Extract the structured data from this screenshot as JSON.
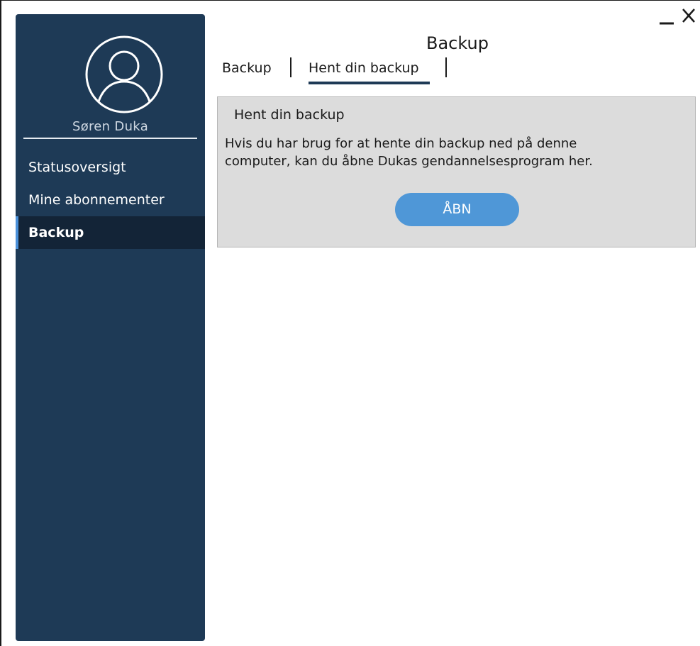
{
  "window": {
    "minimize_icon": "minimize-icon",
    "close_icon": "close-icon"
  },
  "sidebar": {
    "avatar_icon": "user-avatar-icon",
    "user_name": "Søren Duka",
    "items": [
      {
        "label": "Statusoversigt",
        "active": false
      },
      {
        "label": "Mine abonnementer",
        "active": false
      },
      {
        "label": "Backup",
        "active": true
      }
    ]
  },
  "header": {
    "title": "Backup"
  },
  "tabs": [
    {
      "label": "Backup",
      "active": false
    },
    {
      "label": "Hent din backup",
      "active": true
    }
  ],
  "panel": {
    "title": "Hent din backup",
    "text_line1": "Hvis du har brug for at hente din backup ned på denne",
    "text_line2": "computer, kan du åbne Dukas gendannelsesprogram her.",
    "button_label": "ÅBN"
  },
  "colors": {
    "sidebar": "#1e3a56",
    "sidebar_active": "#132437",
    "accent": "#4f97d7",
    "panel": "#dcdcdc"
  }
}
